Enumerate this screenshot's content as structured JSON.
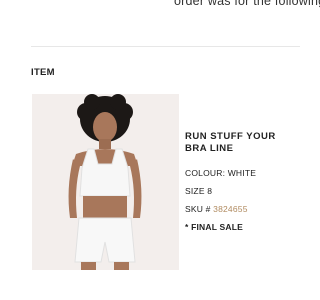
{
  "header": {
    "partial_text": "order was for the following"
  },
  "section": {
    "heading": "ITEM"
  },
  "product": {
    "name": "RUN STUFF YOUR BRA LINE",
    "colour_label": "COLOUR:",
    "colour_value": "WHITE",
    "size_label": "SIZE",
    "size_value": "8",
    "sku_label": "SKU #",
    "sku_value": "3824655",
    "final_sale": "* FINAL SALE"
  },
  "colors": {
    "sku_accent": "#b08a5f",
    "image_background": "#f3eeec"
  }
}
